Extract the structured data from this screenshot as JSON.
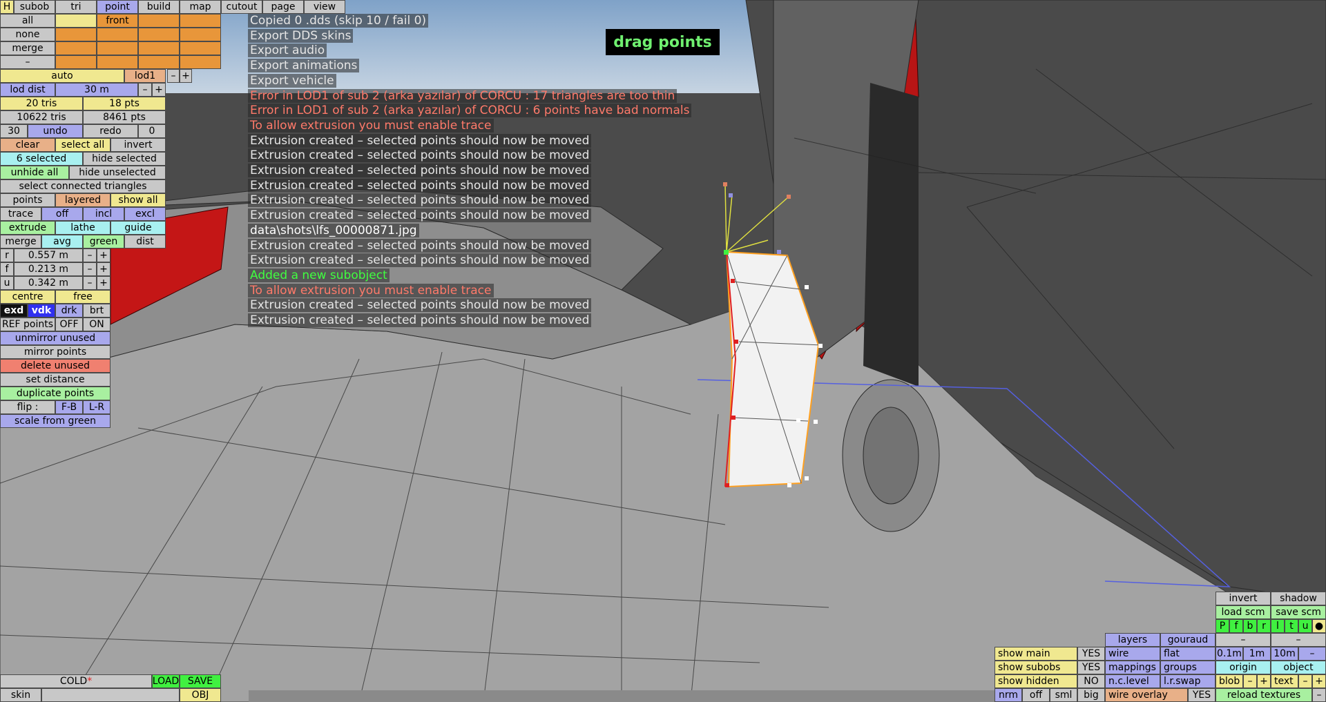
{
  "window": {
    "drag_hint": "drag points"
  },
  "colors": {
    "sky_top": "#87a9cc",
    "ground": "#4b4b4b",
    "mesh": "#9a9a9a",
    "accent_red": "#c81818",
    "selection": "#ffa020"
  },
  "top_tabs": {
    "h": "H",
    "subob": "subob",
    "tri": "tri",
    "point": "point",
    "build": "build",
    "map": "map",
    "cutout": "cutout",
    "page": "page",
    "view": "view"
  },
  "lod_grid": {
    "all": "all",
    "front": "front",
    "none": "none",
    "merge": "merge",
    "dash": "–"
  },
  "lod": {
    "auto": "auto",
    "lod1": "lod1",
    "minus": "–",
    "plus": "+",
    "dist_label": "lod dist",
    "dist_value": "30 m"
  },
  "counts": {
    "tris": "20 tris",
    "pts": "18 pts",
    "total_tris": "10622 tris",
    "total_pts": "8461 pts"
  },
  "history": {
    "count_left": "30",
    "undo": "undo",
    "redo": "redo",
    "count_right": "0"
  },
  "select": {
    "clear": "clear",
    "select_all": "select all",
    "invert": "invert",
    "selected": "6 selected",
    "hide_selected": "hide selected",
    "unhide_all": "unhide all",
    "hide_unselected": "hide unselected",
    "select_connected": "select connected triangles"
  },
  "mode": {
    "points": "points",
    "layered": "layered",
    "show_all": "show all"
  },
  "trace": {
    "label": "trace",
    "off": "off",
    "incl": "incl",
    "excl": "excl"
  },
  "tools": {
    "extrude": "extrude",
    "lathe": "lathe",
    "guide": "guide",
    "merge": "merge",
    "avg": "avg",
    "green": "green",
    "dist": "dist"
  },
  "dims": [
    {
      "key": "r",
      "value": "0.557 m"
    },
    {
      "key": "f",
      "value": "0.213 m"
    },
    {
      "key": "u",
      "value": "0.342 m"
    }
  ],
  "pivot": {
    "centre": "centre",
    "free": "free"
  },
  "shade": {
    "exd": "exd",
    "vdk": "vdk",
    "drk": "drk",
    "brt": "brt"
  },
  "ref": {
    "label": "REF points",
    "off": "OFF",
    "on": "ON"
  },
  "point_ops": {
    "unmirror": "unmirror unused",
    "mirror": "mirror points",
    "delete_unused": "delete unused",
    "set_distance": "set distance",
    "duplicate": "duplicate points",
    "flip_label": "flip :",
    "flip_fb": "F-B",
    "flip_lr": "L-R",
    "scale_green": "scale from green"
  },
  "messages": [
    {
      "text": "Copied 0 .dds (skip 10 / fail 0)",
      "kind": "gray"
    },
    {
      "text": "Export DDS skins",
      "kind": "gray"
    },
    {
      "text": "Export audio",
      "kind": "gray"
    },
    {
      "text": "Export animations",
      "kind": "gray"
    },
    {
      "text": "Export vehicle",
      "kind": "gray"
    },
    {
      "text": "Error in LOD1 of sub 2 (arka yazılar) of CORCU : 17 triangles are too thin",
      "kind": "err"
    },
    {
      "text": "Error in LOD1 of sub 2 (arka yazılar) of CORCU : 6 points have bad normals",
      "kind": "err"
    },
    {
      "text": "To allow extrusion you must enable trace",
      "kind": "err"
    },
    {
      "text": "Extrusion created – selected points should now be moved",
      "kind": "gray"
    },
    {
      "text": "Extrusion created – selected points should now be moved",
      "kind": "gray"
    },
    {
      "text": "Extrusion created – selected points should now be moved",
      "kind": "gray"
    },
    {
      "text": "Extrusion created – selected points should now be moved",
      "kind": "gray"
    },
    {
      "text": "Extrusion created – selected points should now be moved",
      "kind": "gray"
    },
    {
      "text": "Extrusion created – selected points should now be moved",
      "kind": "gray"
    },
    {
      "text": "data\\shots\\lfs_00000871.jpg",
      "kind": "file"
    },
    {
      "text": "Extrusion created – selected points should now be moved",
      "kind": "gray"
    },
    {
      "text": "Extrusion created – selected points should now be moved",
      "kind": "gray"
    },
    {
      "text": "Added a new subobject",
      "kind": "ok"
    },
    {
      "text": "To allow extrusion you must enable trace",
      "kind": "err"
    },
    {
      "text": "Extrusion created – selected points should now be moved",
      "kind": "gray"
    },
    {
      "text": "Extrusion created – selected points should now be moved",
      "kind": "gray"
    }
  ],
  "bottom_left": {
    "file_name": "COLD",
    "modified_mark": "*",
    "load": "LOAD",
    "save": "SAVE",
    "skin": "skin",
    "obj": "OBJ"
  },
  "view_panel": {
    "invert": "invert",
    "shadow": "shadow",
    "load_scm": "load scm",
    "save_scm": "save scm",
    "channels": [
      "P",
      "f",
      "b",
      "r",
      "l",
      "t",
      "u",
      "●"
    ],
    "dash": "–",
    "layers": "layers",
    "gouraud": "gouraud",
    "show_main": "show main",
    "show_main_val": "YES",
    "show_subobs": "show subobs",
    "show_subobs_val": "YES",
    "show_hidden": "show hidden",
    "show_hidden_val": "NO",
    "wire": "wire",
    "flat": "flat",
    "mappings": "mappings",
    "groups": "groups",
    "nc_level": "n.c.level",
    "lr_swap": "l.r.swap",
    "grid_01": "0.1m",
    "grid_1": "1m",
    "grid_10": "10m",
    "origin": "origin",
    "object": "object",
    "blob": "blob",
    "text": "text",
    "minus": "–",
    "plus": "+",
    "nrm": "nrm",
    "off": "off",
    "sml": "sml",
    "big": "big",
    "wire_overlay": "wire overlay",
    "wire_overlay_val": "YES",
    "reload_textures": "reload textures"
  }
}
